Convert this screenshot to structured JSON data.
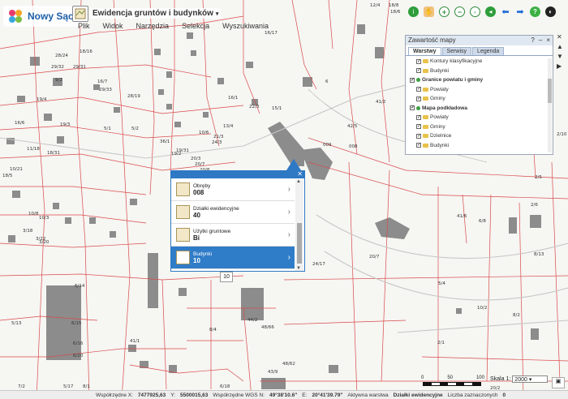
{
  "header": {
    "logo_text": "Nowy Sącz",
    "app_title": "Ewidencja gruntów i budynków",
    "menu": [
      "Plik",
      "Widok",
      "Narzędzia",
      "Selekcja",
      "Wyszukiwania"
    ]
  },
  "toolbar": {
    "icons": [
      "info-icon",
      "pan-hand-icon",
      "zoom-in-icon",
      "zoom-out-icon",
      "zoom-extent-icon",
      "previous-extent-icon",
      "back-arrow-icon",
      "forward-arrow-icon",
      "help-icon",
      "options-icon"
    ]
  },
  "content_panel": {
    "title": "Zawartość mapy",
    "header_buttons": [
      "?",
      "–",
      "×"
    ],
    "tabs": [
      "Warstwy",
      "Serwisy",
      "Legenda"
    ],
    "layers": [
      {
        "label": "Kontury klasyfikacyjne",
        "type": "layer"
      },
      {
        "label": "Budynki",
        "type": "layer"
      },
      {
        "label": "Granice powiatu i gminy",
        "type": "group"
      },
      {
        "label": "Powiaty",
        "type": "layer"
      },
      {
        "label": "Gminy",
        "type": "layer"
      },
      {
        "label": "Mapa podkładowa",
        "type": "group"
      },
      {
        "label": "Powiaty",
        "type": "layer"
      },
      {
        "label": "Gminy",
        "type": "layer"
      },
      {
        "label": "Dzielnice",
        "type": "layer"
      },
      {
        "label": "Budynki",
        "type": "layer"
      }
    ]
  },
  "popup": {
    "rows": [
      {
        "label": "Obręby",
        "value": "008"
      },
      {
        "label": "Działki ewidencyjne",
        "value": "40"
      },
      {
        "label": "Użytki gruntowe",
        "value": "Bi"
      },
      {
        "label": "Budynki",
        "value": "10"
      }
    ],
    "selected_index": 3,
    "page_indicator": "10"
  },
  "map": {
    "labels": [
      "18/8",
      "18/6",
      "12/4",
      "28/24",
      "18/16",
      "16/17",
      "29/32",
      "29/31",
      "9/2",
      "16/7",
      "29/33",
      "28/19",
      "16/1",
      "19/4",
      "16/6",
      "19/3",
      "5/1",
      "5/2",
      "22/3",
      "15/1",
      "6",
      "13/4",
      "20/3",
      "20/7",
      "20/8",
      "19/2",
      "21/3",
      "36/1",
      "10/6",
      "24/3",
      "19/31",
      "009",
      "008",
      "11/18",
      "18/31",
      "10/21",
      "18/5",
      "10/8",
      "10/3",
      "3/18",
      "3/22",
      "3/20",
      "6/14",
      "5/13",
      "7/2",
      "6/15",
      "6/16",
      "6/20",
      "41/1",
      "41/2",
      "42/5",
      "43/9",
      "44/2",
      "48/66",
      "48/62",
      "8/4",
      "6/18",
      "2/5",
      "8/13",
      "6/8",
      "8/2",
      "5/4",
      "10/2",
      "2/6",
      "2/10",
      "2/1",
      "5/17",
      "8/1",
      "24/17",
      "20/7",
      "41/6",
      "20/2"
    ]
  },
  "statusbar": {
    "coord_label": "Współrzędne X:",
    "coord_x": "7477925,63",
    "coord_y_label": "Y:",
    "coord_y": "5500015,63",
    "wgs_label": "Współrzędne WGS N:",
    "wgs_n": "49°38'10.6\"",
    "wgs_e_label": "E:",
    "wgs_e": "20°41'39.79\"",
    "layer_label": "Aktywna warstwa",
    "layer_value": "Działki ewidencyjne",
    "selected_label": "Liczba zaznaczonych",
    "selected_value": "0"
  },
  "scale": {
    "label": "Skala 1:",
    "value": "2000",
    "bar_labels": [
      "0",
      "50",
      "100"
    ]
  }
}
